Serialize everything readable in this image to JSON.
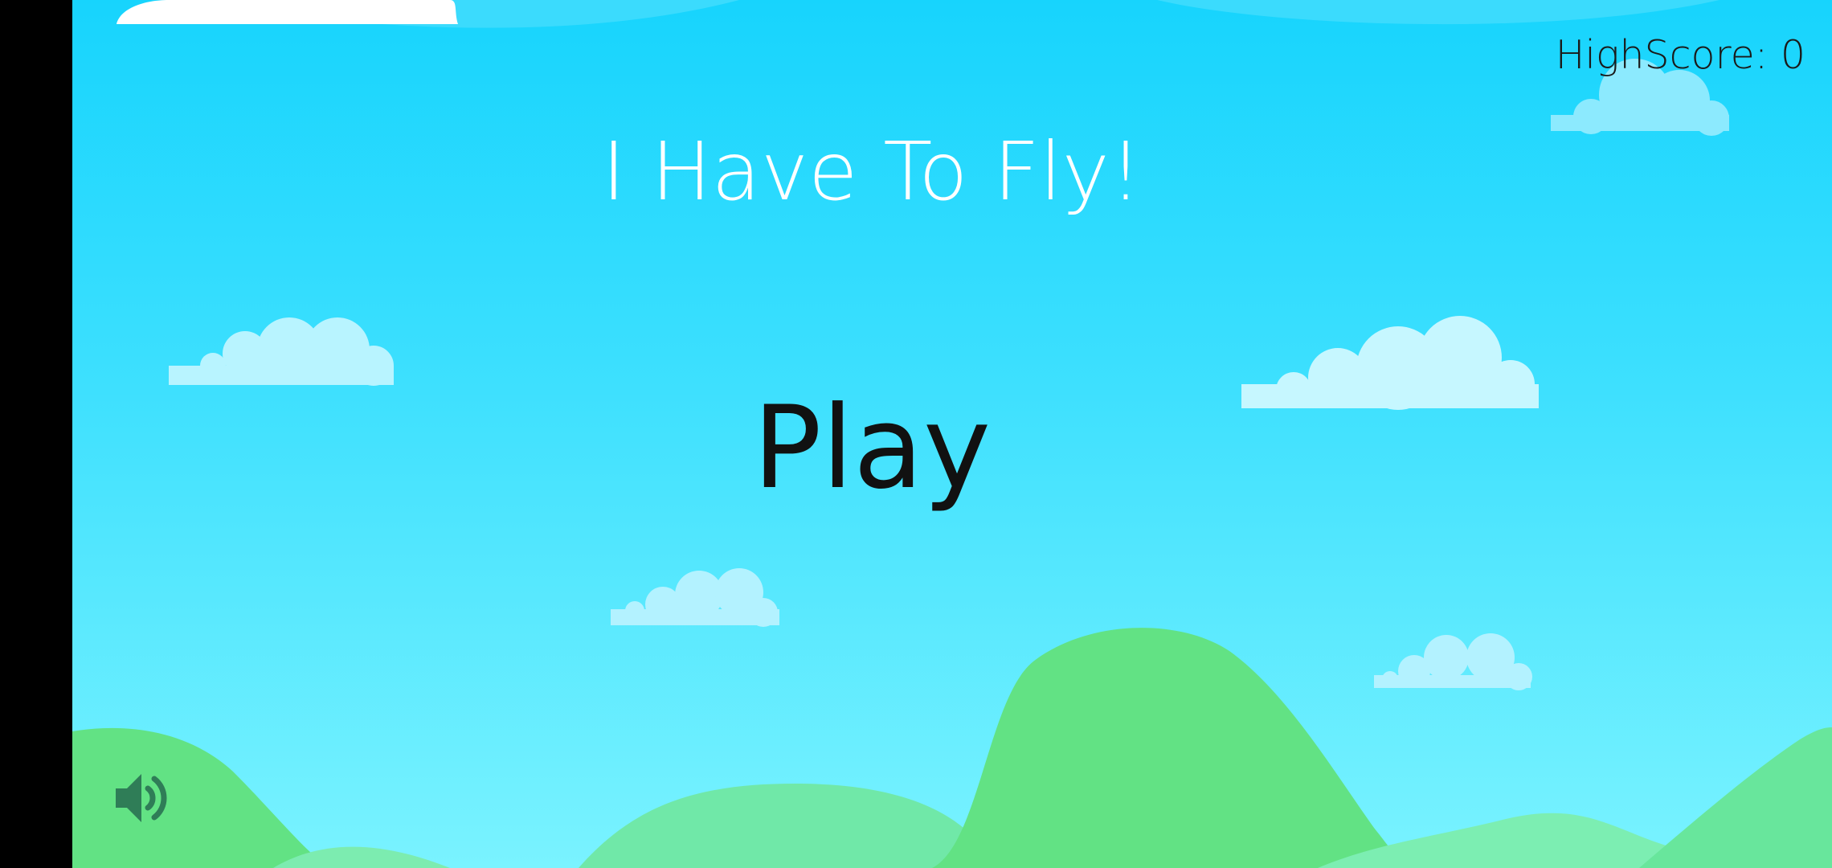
{
  "game": {
    "title": "I Have To Fly!",
    "play_label": "Play",
    "highscore_text": "HighScore: 0",
    "sound_icon": "speaker-volume-icon"
  },
  "colors": {
    "sky_top": "#17d4fd",
    "sky_bottom": "#7af3ff",
    "cloud_light": "#b8f4ff",
    "cloud_white": "#ffffff",
    "hill_green": "#62e284",
    "title_text": "#ffffff",
    "play_text": "#111111",
    "icon_color": "#2f7d57"
  }
}
